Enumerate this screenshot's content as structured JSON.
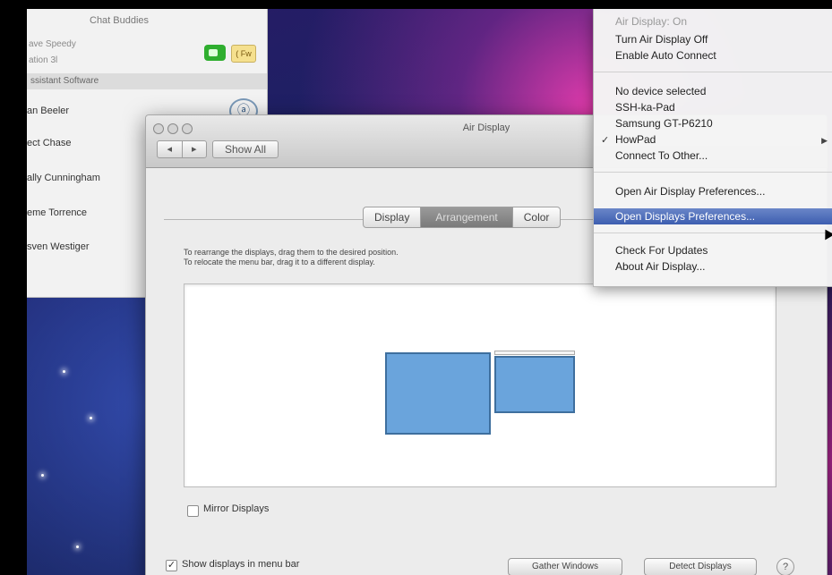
{
  "buddy_list": {
    "title": "Chat Buddies",
    "status": "ave Speedy",
    "sub_status": "ation 3l",
    "group": "ssistant Software",
    "buddies": [
      "an Beeler",
      "ect Chase",
      "ally Cunningham",
      "eme Torrence",
      "sven Westiger"
    ],
    "status_badge": "( Fw"
  },
  "prefs_window": {
    "title": "Air Display",
    "nav_back": "◂",
    "nav_forward": "▸",
    "show_all": "Show All",
    "tabs": [
      {
        "label": "Display",
        "active": false
      },
      {
        "label": "Arrangement",
        "active": true
      },
      {
        "label": "Color",
        "active": false
      }
    ],
    "instruction_1": "To rearrange the displays, drag them to the desired position.",
    "instruction_2": "To relocate the menu bar, drag it to a different display.",
    "mirror_label": "Mirror Displays",
    "mirror_checked": false,
    "show_in_menu_label": "Show displays in menu bar",
    "show_in_menu_checked": true,
    "gather_button": "Gather Windows",
    "detect_button": "Detect Displays",
    "help": "?"
  },
  "menu": {
    "header": "Air Display: On",
    "items_group1": [
      "Turn Air Display Off",
      "Enable Auto Connect"
    ],
    "no_device": "No device selected",
    "devices": [
      "SSH-ka-Pad",
      "Samsung GT-P6210",
      "HowPad"
    ],
    "selected_device": "HowPad",
    "connect_other": "Connect To Other...",
    "prefs_items": [
      "Open Air Display Preferences...",
      "Open Displays Preferences..."
    ],
    "highlighted": "Open Displays Preferences...",
    "update_items": [
      "Check For Updates",
      "About Air Display..."
    ]
  }
}
